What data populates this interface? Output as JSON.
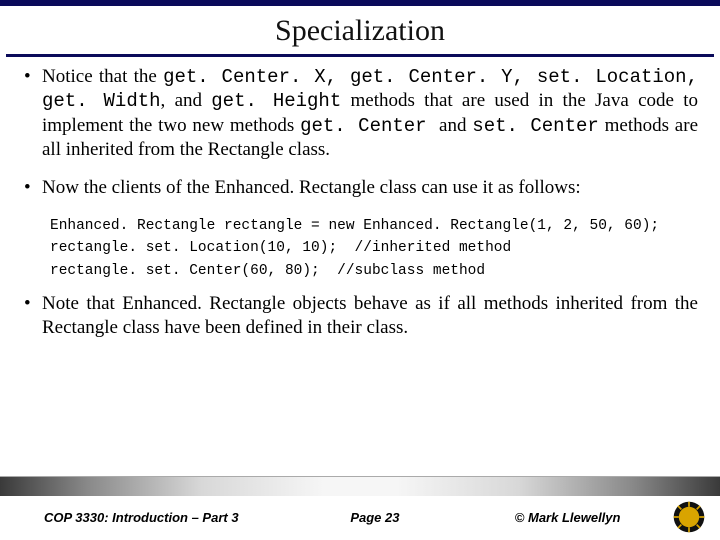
{
  "title": "Specialization",
  "bullets": {
    "b1": {
      "pre": "Notice that the ",
      "m1": "get. Center. X, ",
      "m2": "get. Center. Y, ",
      "m3": "set. Location, ",
      "m4": "get. Width",
      "mid1": ", and ",
      "m5": "get. Height",
      "mid2": " methods that are used in the Java code to implement the two new methods ",
      "m6": "get. Center ",
      "mid3": " and ",
      "m7": "set. Center",
      "post": " methods are all inherited from the Rectangle class."
    },
    "b2": "Now the clients of the Enhanced. Rectangle class can use it as follows:",
    "b3": "Note that Enhanced. Rectangle objects behave as if all methods inherited from the Rectangle class have been defined in their class."
  },
  "code": {
    "l1": "Enhanced. Rectangle rectangle = new Enhanced. Rectangle(1, 2, 50, 60);",
    "l2": "rectangle. set. Location(10, 10);  //inherited method",
    "l3": "rectangle. set. Center(60, 80);  //subclass method"
  },
  "footer": {
    "left": "COP 3330: Introduction – Part 3",
    "mid": "Page 23",
    "right": "© Mark Llewellyn"
  }
}
